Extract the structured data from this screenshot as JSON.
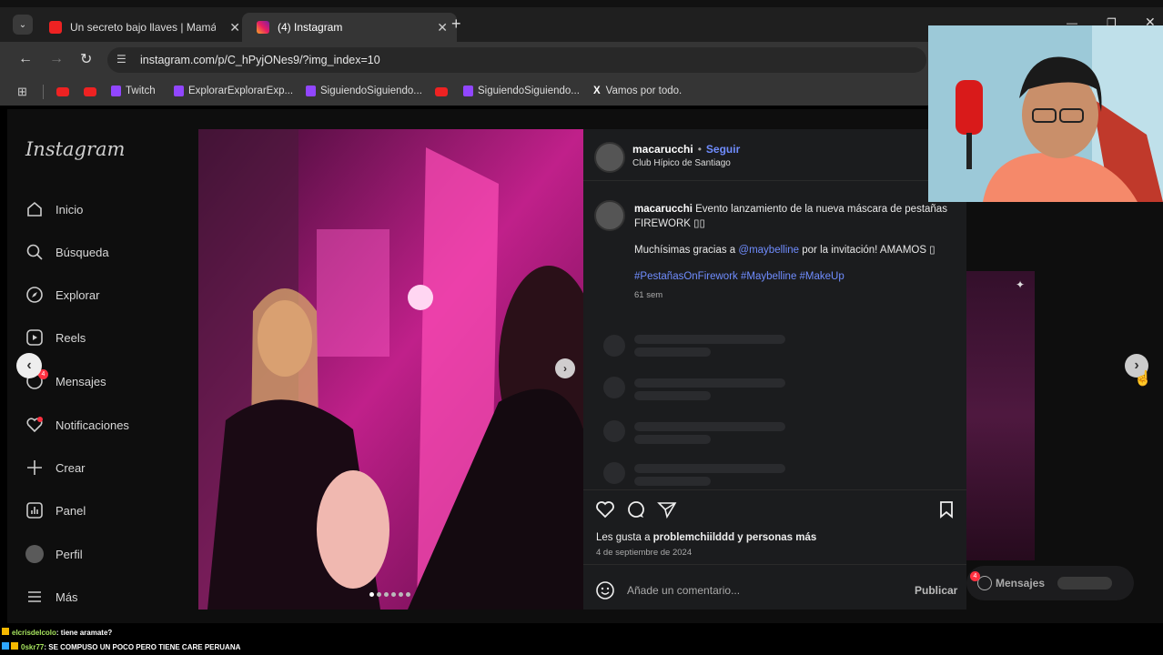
{
  "browser": {
    "tabs": [
      {
        "title": "Un secreto bajo llaves | Mamá a",
        "icon": "youtube-icon"
      },
      {
        "title": "(4) Instagram",
        "icon": "instagram-icon"
      }
    ],
    "url": "instagram.com/p/C_hPyjONes9/?img_index=10",
    "bookmarks": [
      "Twitch",
      "ExplorarExplorarExp...",
      "SiguiendoSiguiendo...",
      "SiguiendoSiguiendo...",
      "Vamos por todo."
    ]
  },
  "instagram": {
    "logo": "Instagram",
    "nav": [
      "Inicio",
      "Búsqueda",
      "Explorar",
      "Reels",
      "Mensajes",
      "Notificaciones",
      "Crear",
      "Panel",
      "Perfil",
      "Más"
    ],
    "nav_badge": "4",
    "post": {
      "username": "macarucchi",
      "follow": "Seguir",
      "separator": "•",
      "location": "Club Hípico de Santiago",
      "caption": "Evento lanzamiento de la nueva máscara de pestañas FIREWORK ▯▯",
      "caption_line2_prefix": "Muchísimas gracias a ",
      "mention": "@maybelline",
      "caption_line2_suffix": " por la invitación! AMAMOS ▯",
      "hashtags": "#PestañasOnFirework #Maybelline #MakeUp",
      "age": "61 sem",
      "likes_prefix": "Les gusta a ",
      "likes_user": "problemchiilddd",
      "likes_suffix": " y personas más",
      "date": "4 de septiembre de 2024",
      "comment_placeholder": "Añade un comentario...",
      "publish": "Publicar"
    },
    "messages_pill": "Mensajes",
    "messages_badge": "4"
  },
  "chat": [
    {
      "user": "elcrisdelcolo",
      "text": ": tiene aramate?"
    },
    {
      "user": "0skr77",
      "text": ": SE COMPUSO UN POCO PERO TIENE CARE PERUANA"
    }
  ],
  "colors": {
    "accent_blue": "#708dff",
    "youtube_red": "#e22222",
    "twitch_purple": "#9146ff"
  }
}
